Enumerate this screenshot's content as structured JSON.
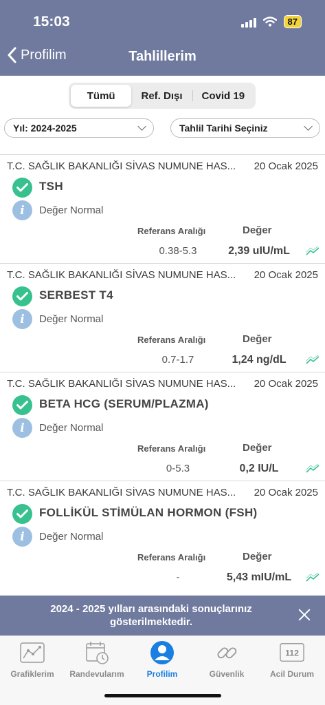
{
  "status": {
    "time": "15:03",
    "battery": "87"
  },
  "nav": {
    "back_label": "Profilim",
    "title": "Tahlillerim"
  },
  "segments": [
    "Tümü",
    "Ref. Dışı",
    "Covid 19"
  ],
  "filters": {
    "year": "Yıl: 2024-2025",
    "date": "Tahlil Tarihi Seçiniz"
  },
  "labels": {
    "ref_header": "Referans Aralığı",
    "value_header": "Değer"
  },
  "results": [
    {
      "hospital": "T.C. SAĞLIK BAKANLIĞI SİVAS NUMUNE HAS...",
      "date": "20 Ocak 2025",
      "name": "TSH",
      "status": "Değer Normal",
      "ref": "0.38-5.3",
      "value": "2,39 uIU/mL"
    },
    {
      "hospital": "T.C. SAĞLIK BAKANLIĞI SİVAS NUMUNE HAS...",
      "date": "20 Ocak 2025",
      "name": "SERBEST T4",
      "status": "Değer Normal",
      "ref": "0.7-1.7",
      "value": "1,24 ng/dL"
    },
    {
      "hospital": "T.C. SAĞLIK BAKANLIĞI SİVAS NUMUNE HAS...",
      "date": "20 Ocak 2025",
      "name": "BETA HCG (SERUM/PLAZMA)",
      "status": "Değer Normal",
      "ref": "0-5.3",
      "value": "0,2 IU/L"
    },
    {
      "hospital": "T.C. SAĞLIK BAKANLIĞI SİVAS NUMUNE HAS...",
      "date": "20 Ocak 2025",
      "name": "FOLLİKÜL STİMÜLAN HORMON (FSH)",
      "status": "Değer Normal",
      "ref": "-",
      "value": "5,43 mIU/mL"
    }
  ],
  "banner": {
    "text": "2024 - 2025 yılları arasındaki sonuçlarınız gösterilmektedir."
  },
  "tabs": [
    {
      "label": "Grafiklerim",
      "icon": "chart-icon"
    },
    {
      "label": "Randevularım",
      "icon": "calendar-clock-icon"
    },
    {
      "label": "Profilim",
      "icon": "profile-icon"
    },
    {
      "label": "Güvenlik",
      "icon": "link-icon"
    },
    {
      "label": "Acil Durum",
      "icon": "emergency-112-icon",
      "badge": "112"
    }
  ],
  "colors": {
    "header": "#6f7a9e",
    "accent": "#1a7fe0",
    "check": "#36c18e",
    "trend": "#36c18e"
  }
}
